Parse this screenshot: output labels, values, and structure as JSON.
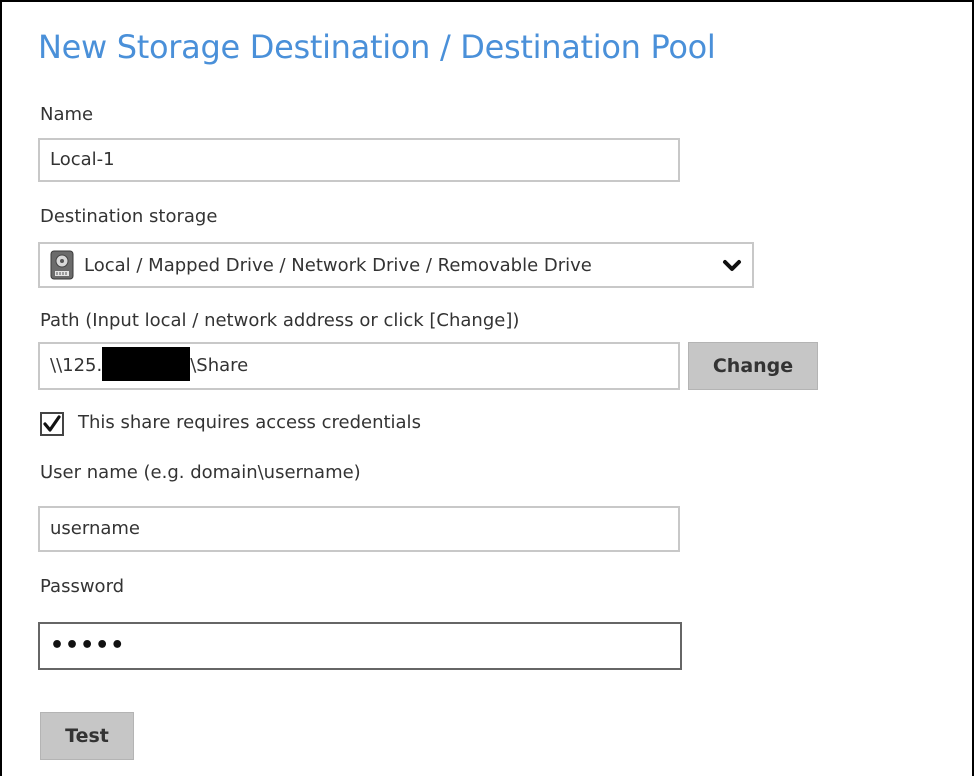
{
  "dialog": {
    "title": "New Storage Destination / Destination Pool"
  },
  "form": {
    "name": {
      "label": "Name",
      "value": "Local-1"
    },
    "destination_storage": {
      "label": "Destination storage",
      "selected": "Local / Mapped Drive / Network Drive / Removable Drive",
      "icon": "hard-drive-icon"
    },
    "path": {
      "label": "Path (Input local / network address or click [Change])",
      "value_prefix": "\\\\125.",
      "value_suffix": "\\Share",
      "change_button": "Change"
    },
    "credentials_checkbox": {
      "label": "This share requires access credentials",
      "checked": true
    },
    "username": {
      "label": "User name (e.g. domain\\username)",
      "value": "username"
    },
    "password": {
      "label": "Password",
      "value": "•••••"
    },
    "test_button": "Test"
  },
  "colors": {
    "title": "#4a90d9",
    "button_bg": "#c6c6c6",
    "input_border": "#c8c8c8",
    "focused_border": "#666666"
  }
}
